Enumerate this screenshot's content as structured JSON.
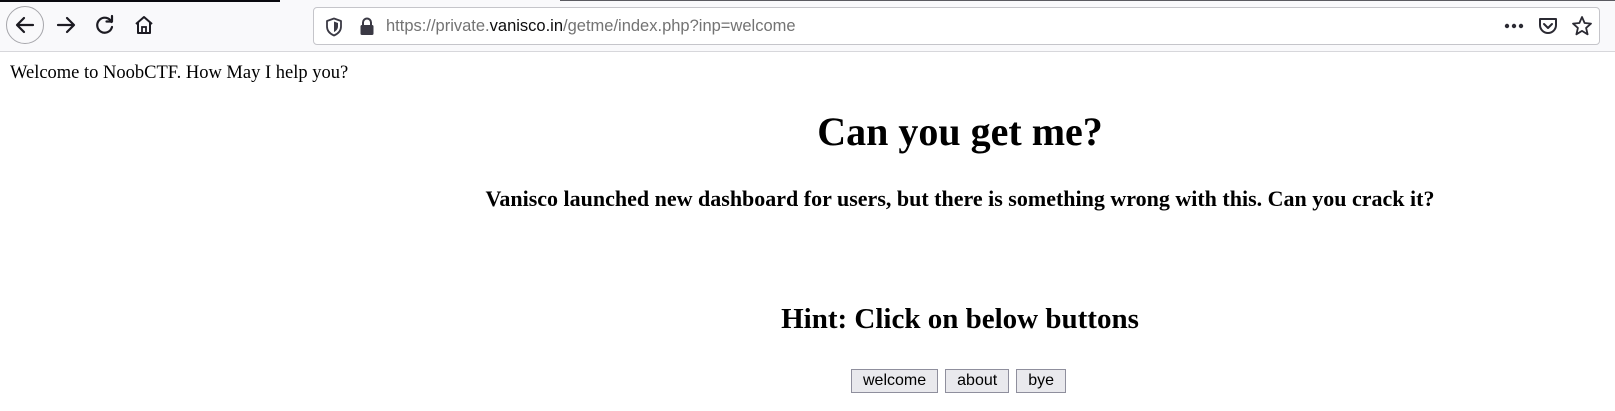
{
  "browser": {
    "url_prefix": "https://private.",
    "url_host": "vanisco.in",
    "url_path": "/getme/index.php?inp=welcome",
    "icons": [
      "back-arrow-icon",
      "forward-arrow-icon",
      "reload-icon",
      "home-icon",
      "shield-icon",
      "lock-icon",
      "more-icon",
      "pocket-icon",
      "star-icon"
    ]
  },
  "page": {
    "welcome_text": "Welcome to NoobCTF. How May I help you?",
    "title": "Can you get me?",
    "subtitle": "Vanisco launched new dashboard for users, but there is something wrong with this. Can you crack it?",
    "hint": "Hint: Click on below buttons",
    "buttons": [
      "welcome",
      "about",
      "bye"
    ]
  }
}
